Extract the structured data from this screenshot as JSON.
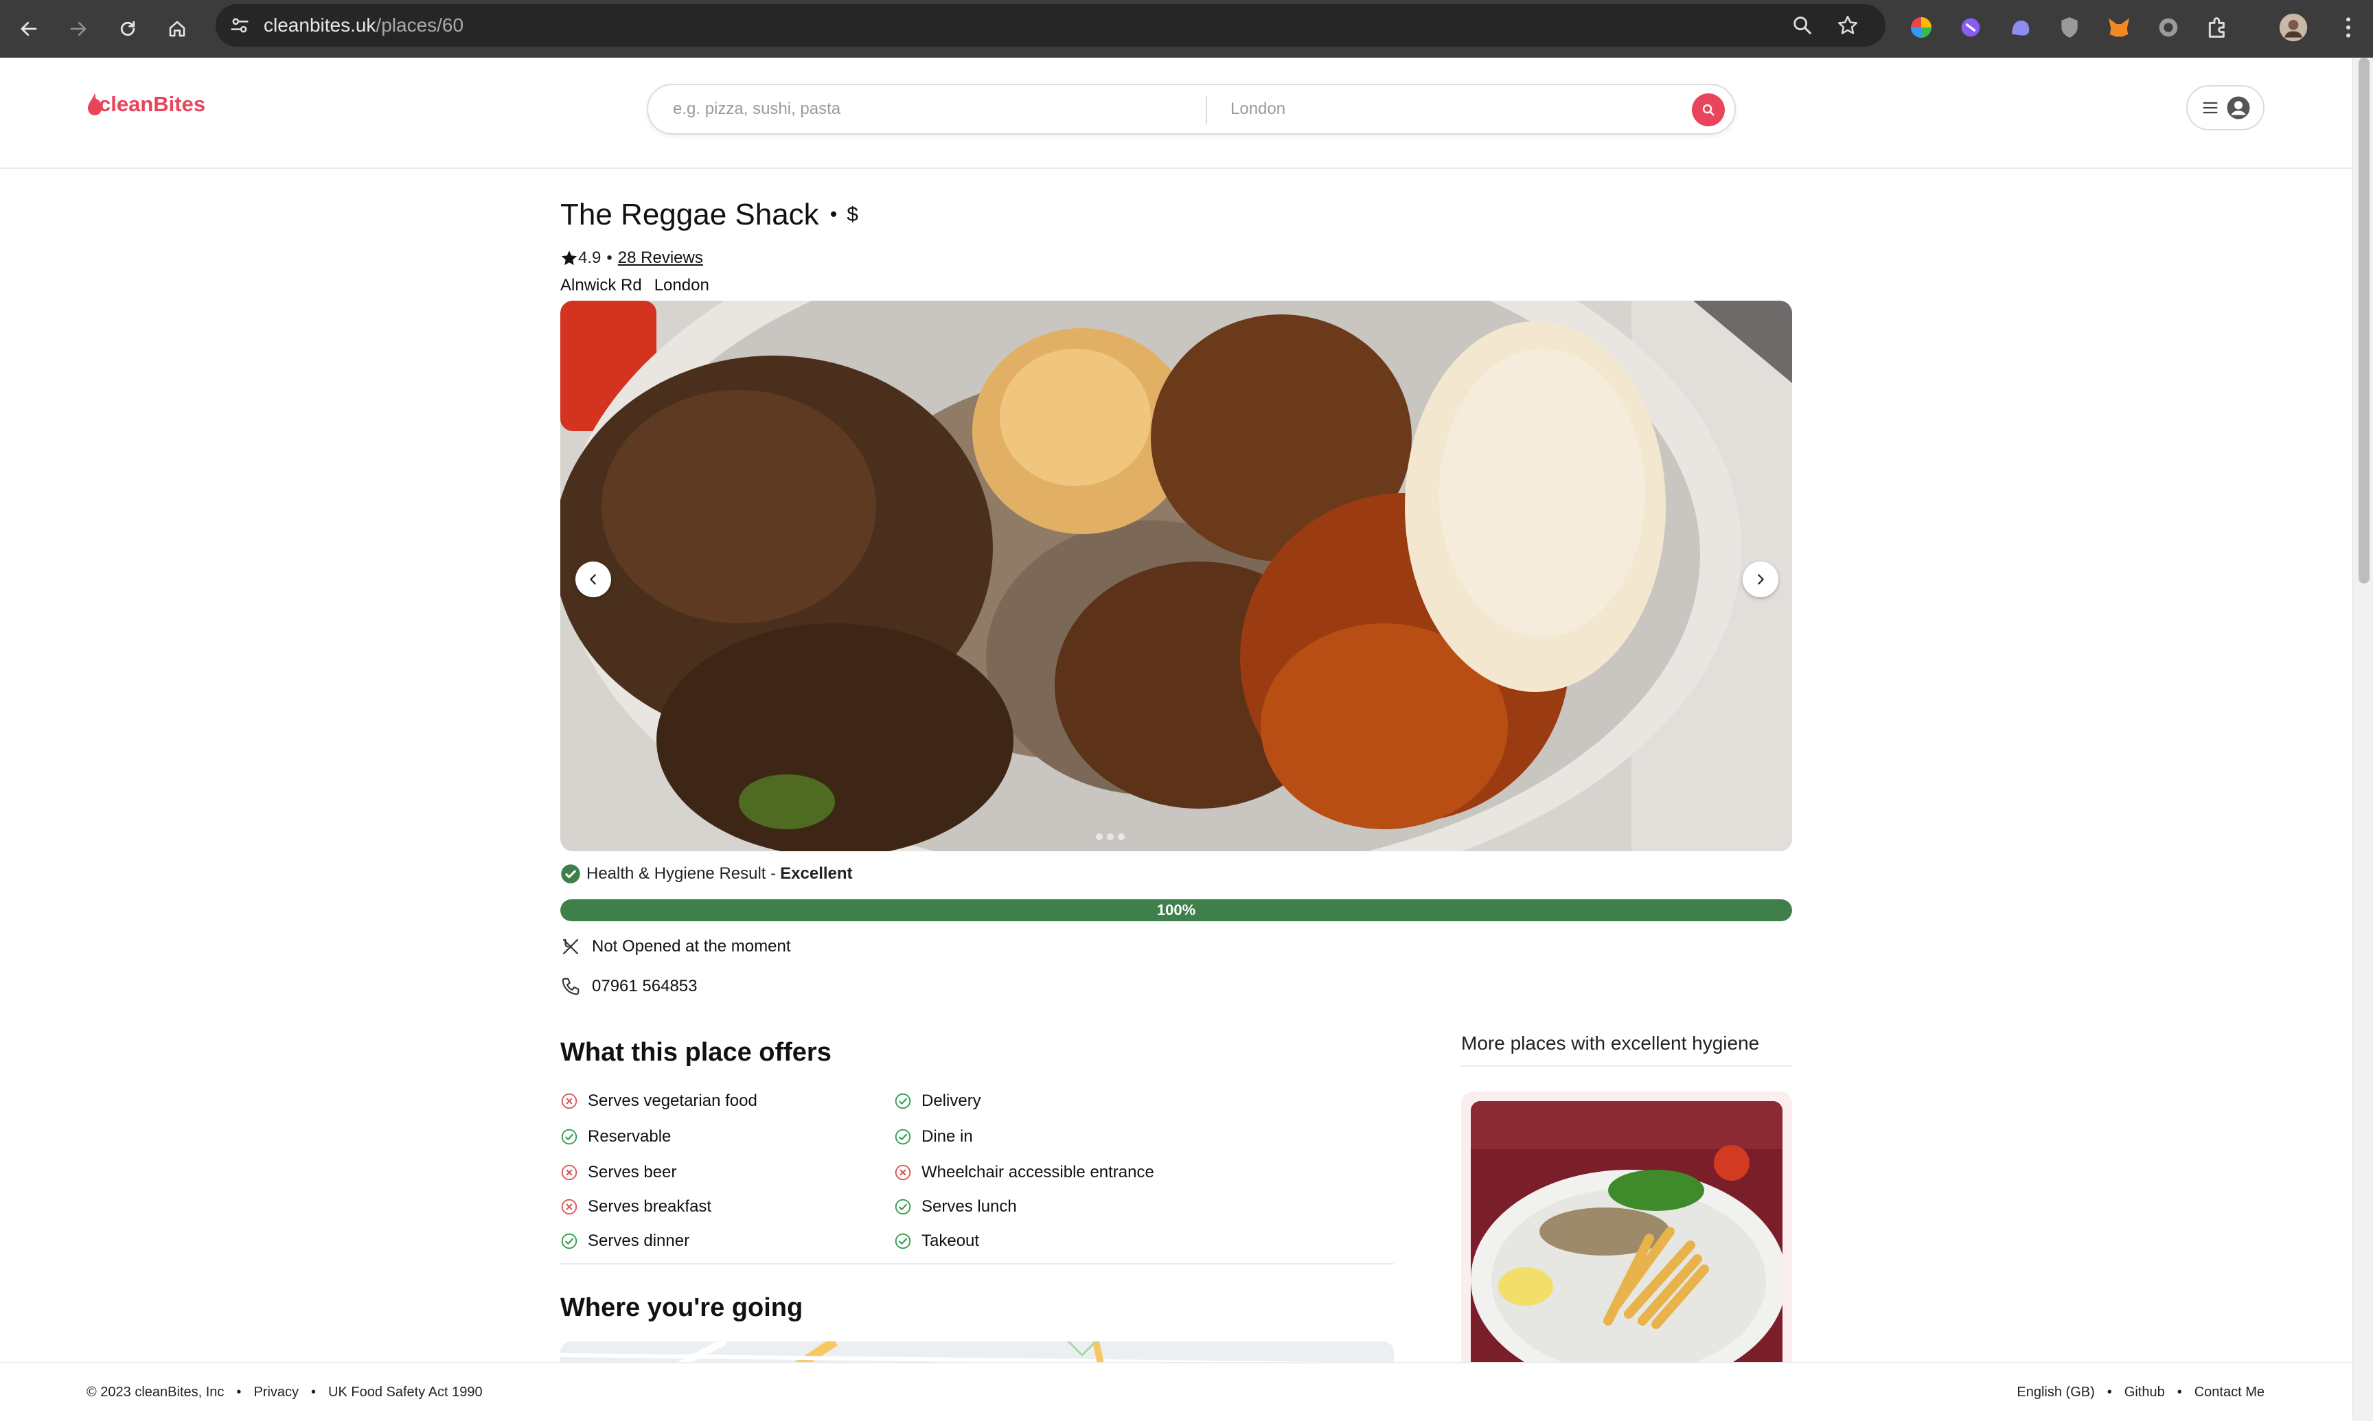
{
  "browser": {
    "url_domain": "cleanbites.uk",
    "url_path": "/places/60"
  },
  "header": {
    "logo_text": "cleanBites",
    "search_placeholder": "e.g. pizza, sushi, pasta",
    "location_placeholder": "London"
  },
  "place": {
    "name": "The Reggae Shack",
    "price": "$",
    "rating": "4.9",
    "reviews": "28 Reviews",
    "street": "Alnwick Rd",
    "city": "London",
    "hygiene_label": "Health & Hygiene Result - ",
    "hygiene_value": "Excellent",
    "hygiene_percent_text": "100%",
    "hygiene_fraction": 1.0,
    "status": "Not Opened at the moment",
    "phone": "07961 564853",
    "gallery_count": 3
  },
  "offers": {
    "title": "What this place offers",
    "items": [
      {
        "label": "Serves vegetarian food",
        "available": false
      },
      {
        "label": "Delivery",
        "available": true
      },
      {
        "label": "Reservable",
        "available": true
      },
      {
        "label": "Dine in",
        "available": true
      },
      {
        "label": "Serves beer",
        "available": false
      },
      {
        "label": "Wheelchair accessible entrance",
        "available": false
      },
      {
        "label": "Serves breakfast",
        "available": false
      },
      {
        "label": "Serves lunch",
        "available": true
      },
      {
        "label": "Serves dinner",
        "available": true
      },
      {
        "label": "Takeout",
        "available": true
      }
    ]
  },
  "going": {
    "title": "Where you're going"
  },
  "sidebar": {
    "title": "More places with excellent hygiene"
  },
  "footer": {
    "copyright": "© 2023 cleanBites, Inc",
    "privacy": "Privacy",
    "act": "UK Food Safety Act 1990",
    "language": "English (GB)",
    "github": "Github",
    "contact": "Contact Me"
  },
  "colors": {
    "brand": "#e8445c",
    "success": "#3f7f4a",
    "unavailable": "#d9534f",
    "available": "#2e9c48"
  }
}
